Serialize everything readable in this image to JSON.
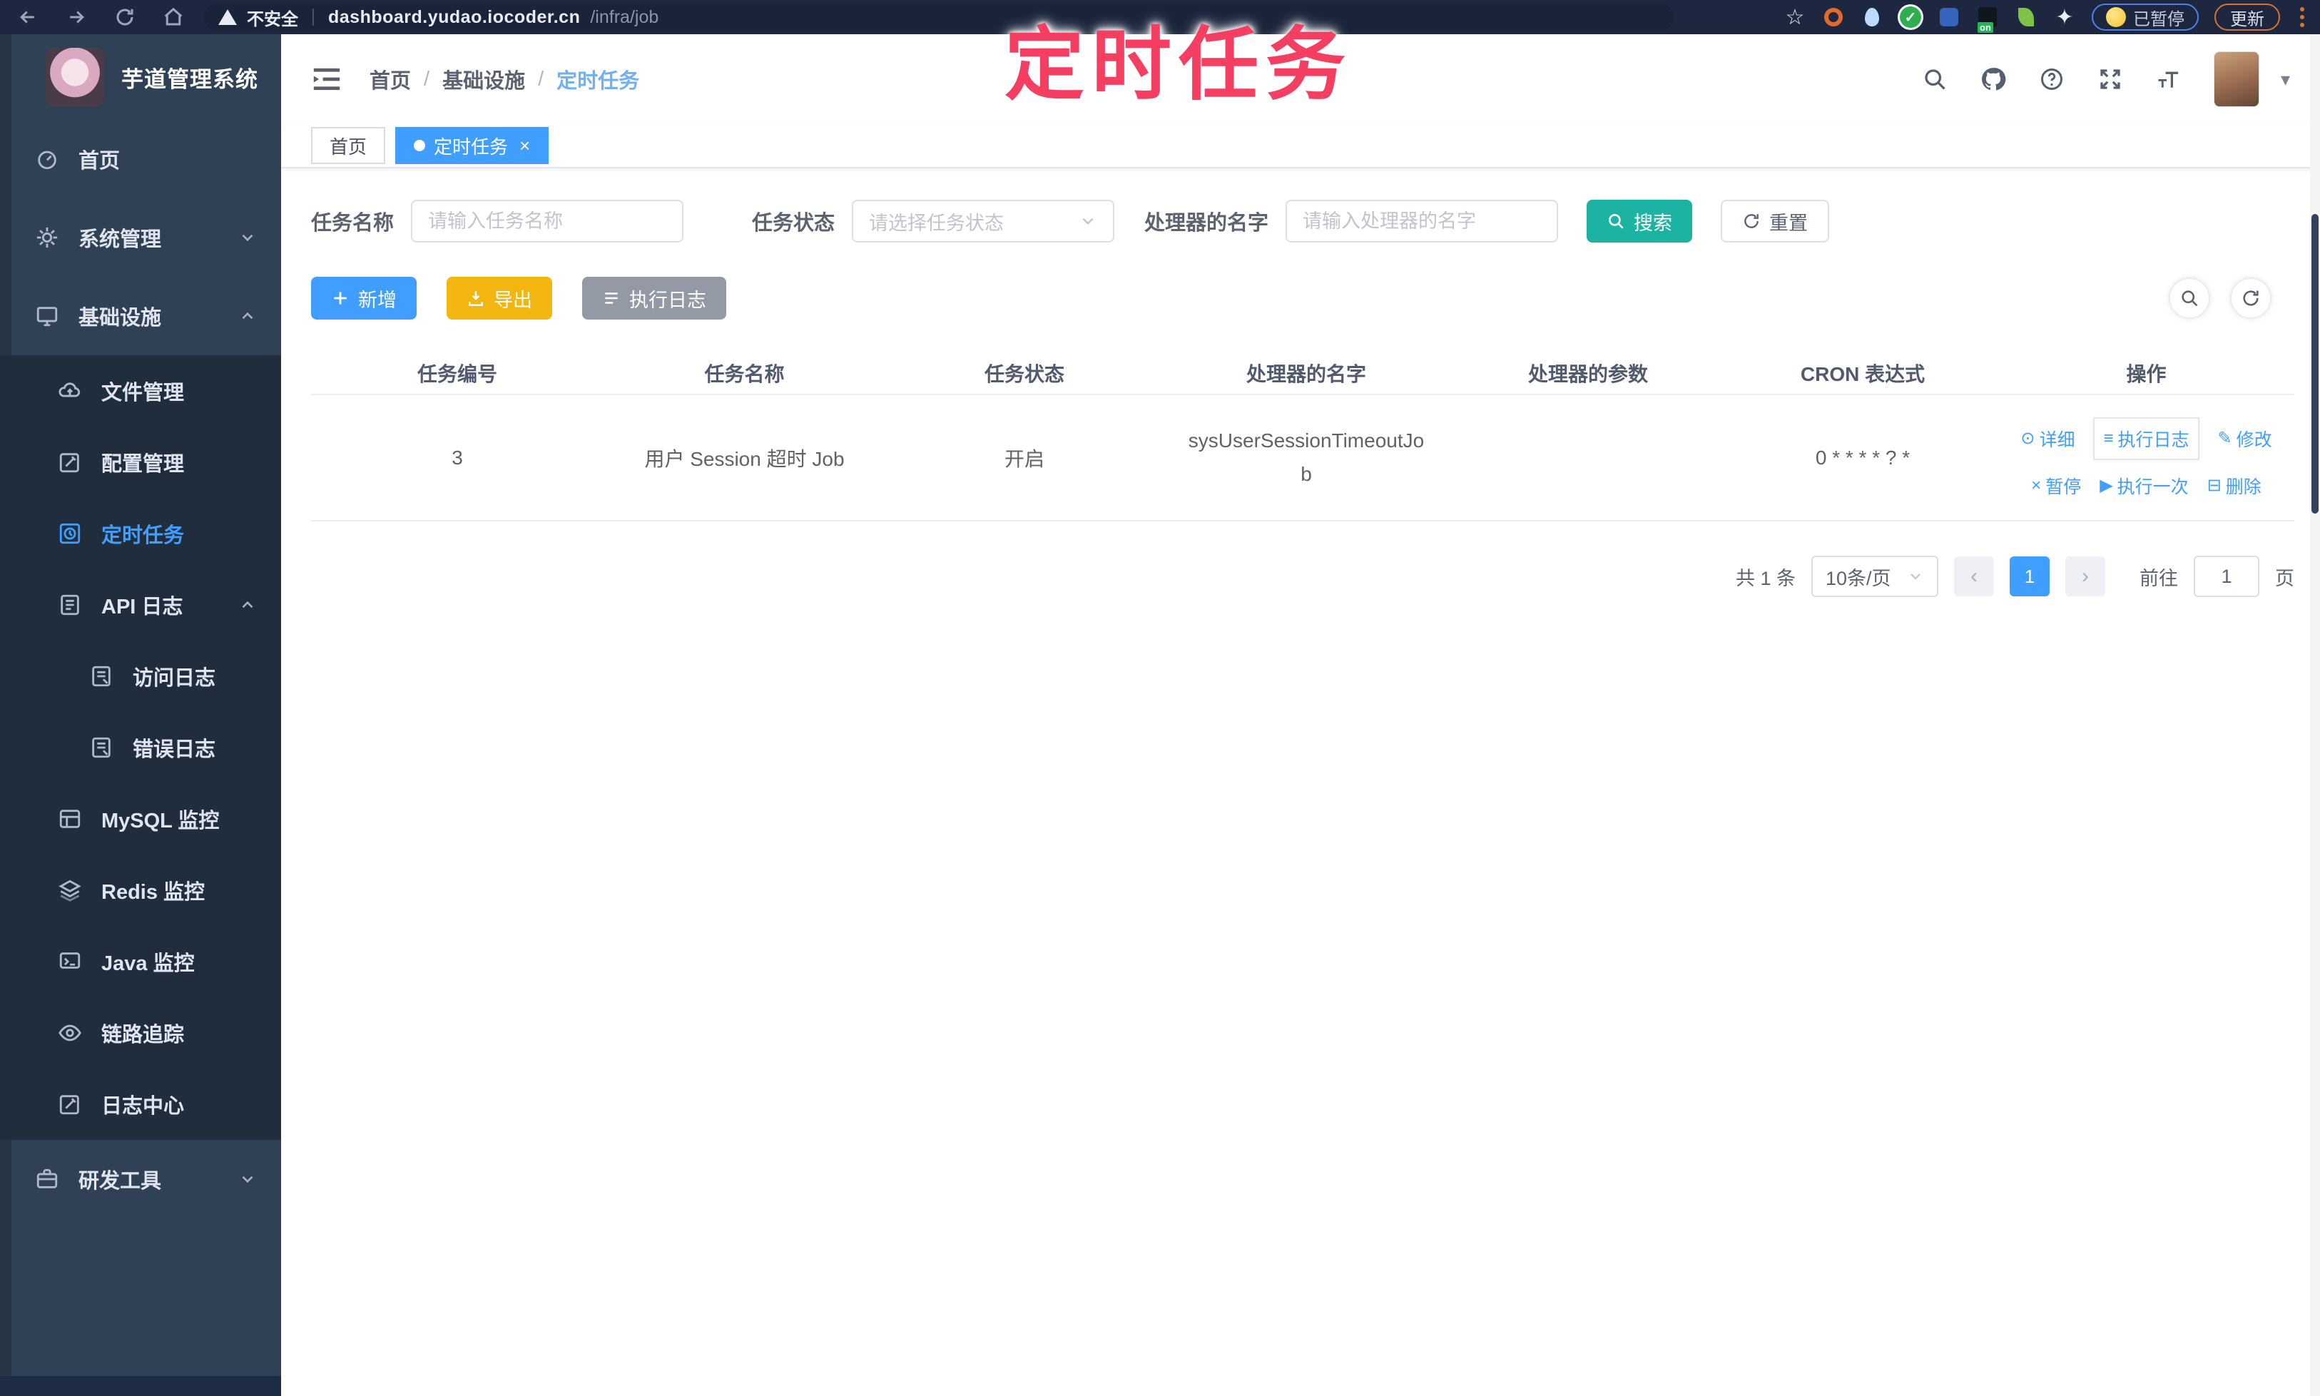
{
  "annotation": {
    "text": "定时任务"
  },
  "browser": {
    "security_label": "不安全",
    "url_host": "dashboard.yudao.iocoder.cn",
    "url_path": "/infra/job",
    "on_badge": "on",
    "paused_badge": "已暂停",
    "update_button": "更新"
  },
  "sidebar": {
    "title": "芋道管理系统",
    "items": [
      {
        "label": "首页"
      },
      {
        "label": "系统管理"
      },
      {
        "label": "基础设施"
      },
      {
        "label": "文件管理"
      },
      {
        "label": "配置管理"
      },
      {
        "label": "定时任务"
      },
      {
        "label": "API 日志"
      },
      {
        "label": "访问日志"
      },
      {
        "label": "错误日志"
      },
      {
        "label": "MySQL 监控"
      },
      {
        "label": "Redis 监控"
      },
      {
        "label": "Java 监控"
      },
      {
        "label": "链路追踪"
      },
      {
        "label": "日志中心"
      },
      {
        "label": "研发工具"
      }
    ]
  },
  "breadcrumb": {
    "separator": "/",
    "items": [
      {
        "label": "首页"
      },
      {
        "label": "基础设施"
      },
      {
        "label": "定时任务"
      }
    ]
  },
  "tabs": [
    {
      "label": "首页"
    },
    {
      "label": "定时任务"
    }
  ],
  "icons": {
    "tab_close": "×",
    "caret": "▾",
    "prev": "‹",
    "next": "›",
    "star": "☆"
  },
  "filters": {
    "name_label": "任务名称",
    "name_placeholder": "请输入任务名称",
    "status_label": "任务状态",
    "status_placeholder": "请选择任务状态",
    "handler_label": "处理器的名字",
    "handler_placeholder": "请输入处理器的名字",
    "search_label": "搜索",
    "reset_label": "重置"
  },
  "toolbar": {
    "add_label": "新增",
    "export_label": "导出",
    "exec_log_label": "执行日志"
  },
  "table": {
    "columns": [
      "任务编号",
      "任务名称",
      "任务状态",
      "处理器的名字",
      "处理器的参数",
      "CRON 表达式",
      "操作"
    ],
    "row": {
      "id": "3",
      "name": "用户 Session 超时 Job",
      "status": "开启",
      "handler": "sysUserSessionTimeoutJob",
      "params": "",
      "cron": "0 * * * * ? *"
    },
    "actions": {
      "detail": "详细",
      "exec_log": "执行日志",
      "edit": "修改",
      "pause": "暂停",
      "run_once": "执行一次",
      "delete": "删除"
    }
  },
  "pagination": {
    "total": "共 1 条",
    "page_size": "10条/页",
    "page": "1",
    "goto_label": "前往",
    "goto_value": "1",
    "unit_label": "页"
  }
}
